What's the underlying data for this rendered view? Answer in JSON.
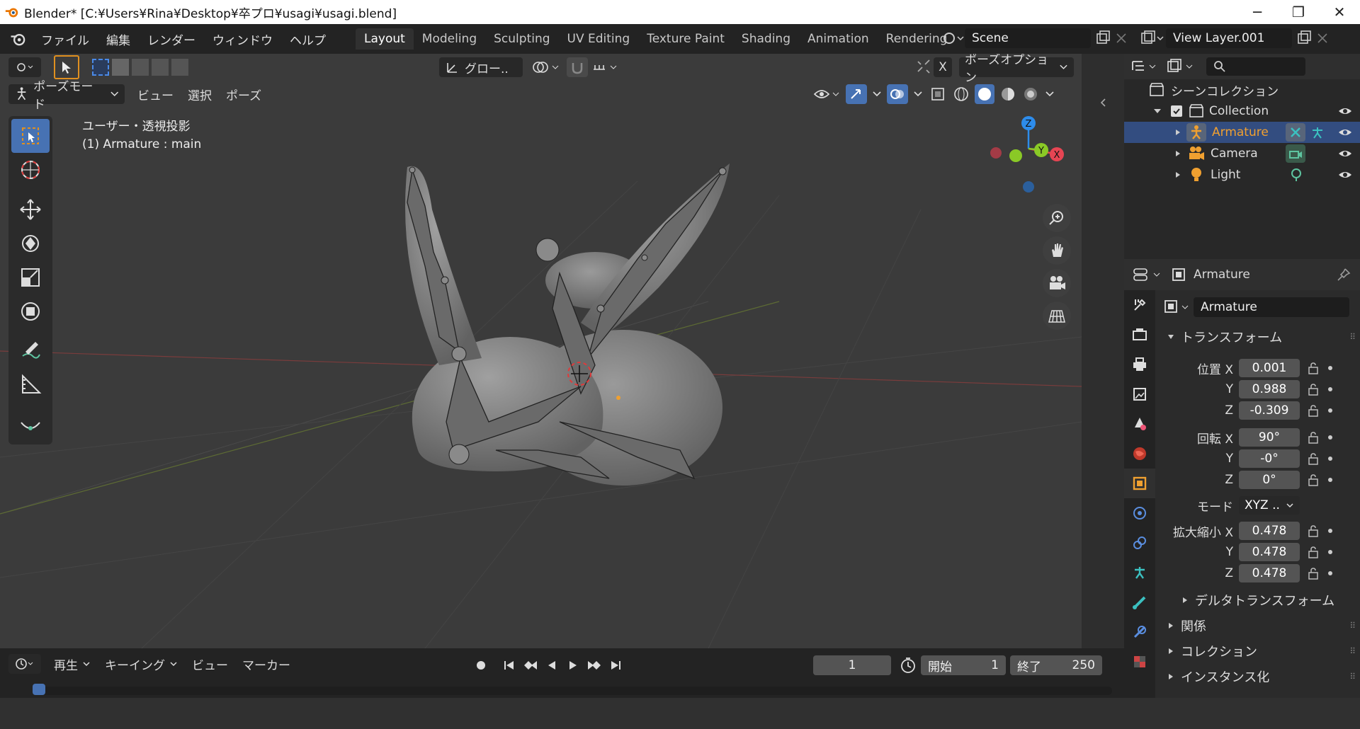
{
  "window": {
    "title": "Blender* [C:¥Users¥Rina¥Desktop¥卒プロ¥usagi¥usagi.blend]",
    "minimize": "─",
    "restore": "❐",
    "close": "✕"
  },
  "menubar": {
    "items": [
      "ファイル",
      "編集",
      "レンダー",
      "ウィンドウ",
      "ヘルプ"
    ]
  },
  "workspaces": {
    "tabs": [
      "Layout",
      "Modeling",
      "Sculpting",
      "UV Editing",
      "Texture Paint",
      "Shading",
      "Animation",
      "Rendering"
    ],
    "active": "Layout"
  },
  "scene": {
    "name": "Scene"
  },
  "viewlayer": {
    "name": "View Layer.001"
  },
  "viewport": {
    "transform_orientation": "グロー..",
    "pose_options": "ポーズオプション",
    "mode": "ポーズモード",
    "menus": [
      "ビュー",
      "選択",
      "ポーズ"
    ],
    "view_label": "ユーザー・透視投影",
    "object_label": "(1) Armature : main",
    "x_label": "X",
    "gizmo": {
      "x": "X",
      "y": "Y",
      "z": "Z"
    }
  },
  "outliner": {
    "root": "シーンコレクション",
    "collection": "Collection",
    "items": [
      {
        "name": "Armature",
        "selected": true
      },
      {
        "name": "Camera",
        "selected": false
      },
      {
        "name": "Light",
        "selected": false
      }
    ]
  },
  "properties": {
    "header_object": "Armature",
    "object_name": "Armature",
    "transform_title": "トランスフォーム",
    "location_label": "位置",
    "location": {
      "x": "0.001",
      "y": "0.988",
      "z": "-0.309"
    },
    "rotation_label": "回転",
    "rotation": {
      "x": "90°",
      "y": "-0°",
      "z": "0°"
    },
    "mode_label": "モード",
    "mode_value": "XYZ ..",
    "scale_label": "拡大縮小",
    "scale": {
      "x": "0.478",
      "y": "0.478",
      "z": "0.478"
    },
    "axis_x": "X",
    "axis_y": "Y",
    "axis_z": "Z",
    "delta_title": "デルタトランスフォーム",
    "relations_title": "関係",
    "collection_title": "コレクション",
    "instancing_title": "インスタンス化"
  },
  "timeline": {
    "playback": "再生",
    "keying": "キーイング",
    "view": "ビュー",
    "marker": "マーカー",
    "current_frame": "1",
    "start_label": "開始",
    "start": "1",
    "end_label": "終了",
    "end": "250"
  },
  "colors": {
    "accent": "#4772b3",
    "selected_row": "#334d80",
    "armature_orange": "#f0a030",
    "axis_x": "#e64553",
    "axis_y": "#8ac926",
    "axis_z": "#2d8ceb"
  }
}
